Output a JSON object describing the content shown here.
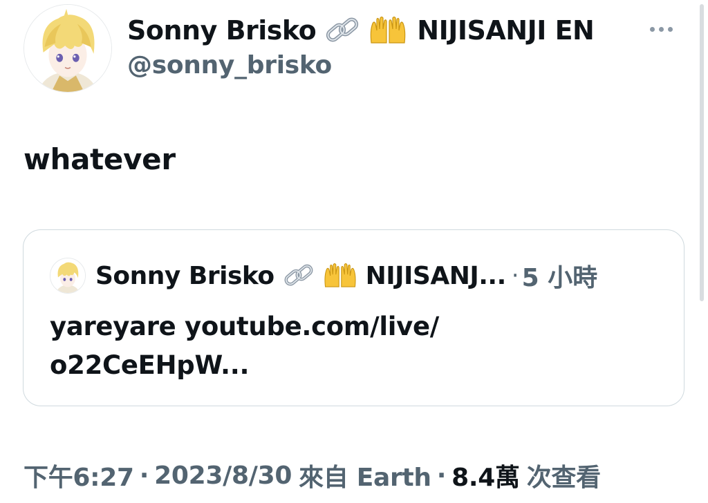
{
  "author": {
    "display_name": "Sonny Brisko",
    "affiliation": "NIJISANJI EN",
    "handle": "@sonny_brisko",
    "avatar_icon": "anime-avatar-blonde-icon",
    "emojis": [
      "link-emoji-icon",
      "palms-up-emoji-icon"
    ]
  },
  "more_menu_label": "More",
  "tweet": {
    "text": "whatever"
  },
  "quoted_tweet": {
    "display_name": "Sonny Brisko",
    "affiliation_truncated": "NIJISANJ...",
    "separator": "·",
    "time_ago": "5 小時",
    "text_line1": "yareyare youtube.com/live/",
    "text_line2": "o22CeEHpW..."
  },
  "meta": {
    "time": "下午6:27",
    "separator": "·",
    "date": "2023/8/30",
    "source": "來自 Earth",
    "views_count": "8.4萬",
    "views_label": "次查看"
  },
  "colors": {
    "text_primary": "#0f1419",
    "text_secondary": "#536471",
    "border": "#cfd9de"
  }
}
